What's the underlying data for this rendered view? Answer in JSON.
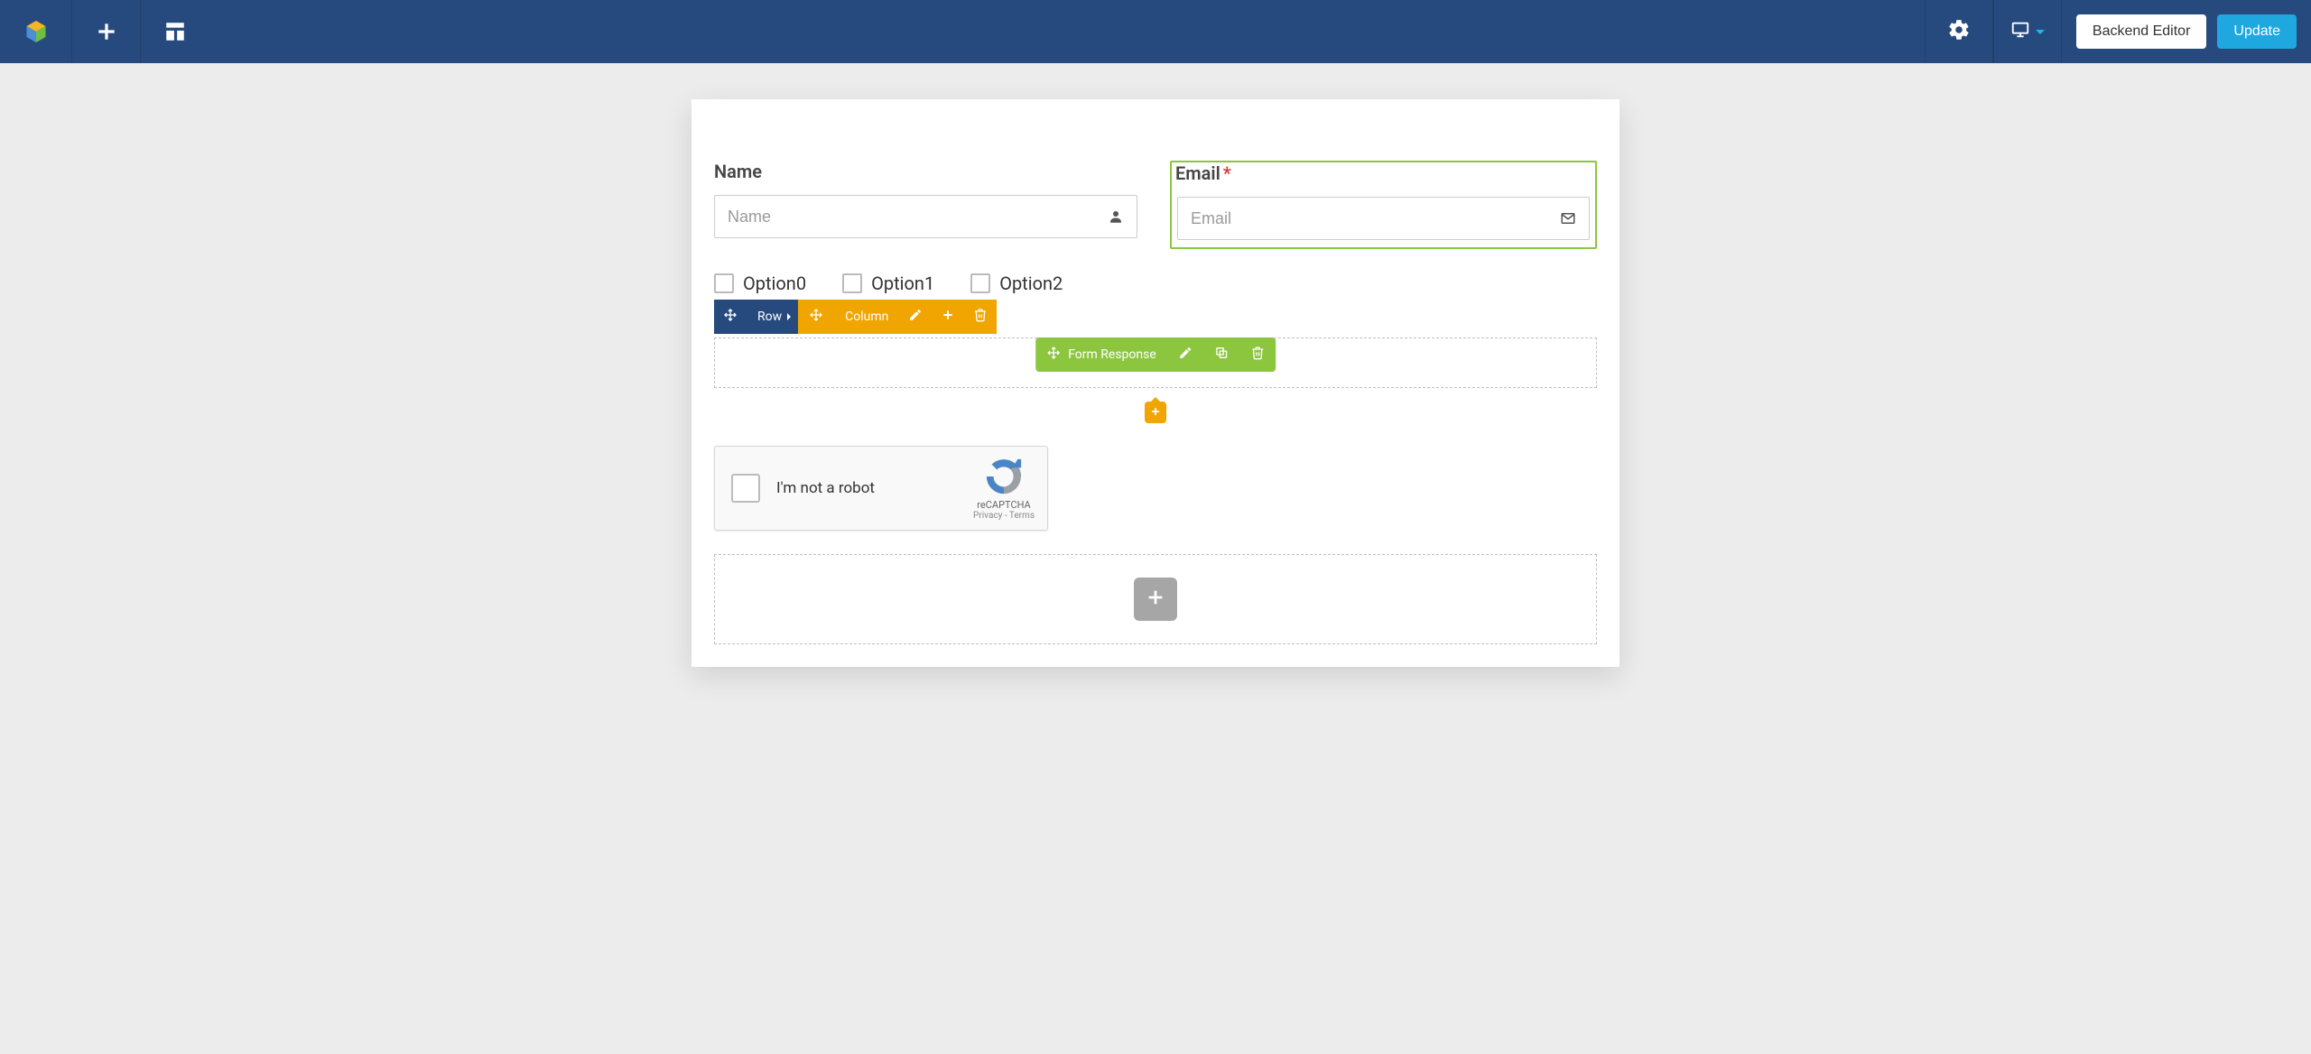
{
  "topbar": {
    "backend_editor_label": "Backend Editor",
    "update_label": "Update"
  },
  "form": {
    "name": {
      "label": "Name",
      "placeholder": "Name",
      "required": false
    },
    "email": {
      "label": "Email",
      "placeholder": "Email",
      "required": true,
      "required_mark": "*"
    },
    "options": [
      {
        "label": "Option0"
      },
      {
        "label": "Option1"
      },
      {
        "label": "Option2"
      }
    ]
  },
  "controls": {
    "row_label": "Row",
    "column_label": "Column",
    "form_response_label": "Form Response"
  },
  "recaptcha": {
    "text": "I'm not a robot",
    "brand": "reCAPTCHA",
    "links": "Privacy - Terms"
  }
}
